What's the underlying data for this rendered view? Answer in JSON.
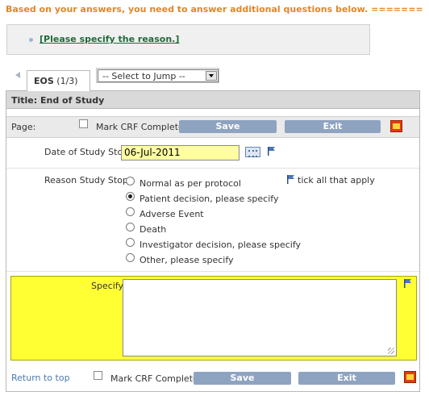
{
  "notice": {
    "message": "Based on your answers, you need to answer additional questions below. =======",
    "link": "[Please specify the reason.]"
  },
  "tabs": {
    "active_name": "EOS",
    "active_count": "(1/3)",
    "jump_select": "-- Select to Jump --"
  },
  "form": {
    "title": "Title: End of Study",
    "page_label": "Page:",
    "mark_complete_label": "Mark CRF Complete",
    "save_label": "Save",
    "exit_label": "Exit",
    "date_label": "Date of Study Stop",
    "date_value": "06-Jul-2011",
    "reason_label": "Reason Study Stop",
    "tick_hint": "tick all that apply",
    "reasons": [
      {
        "label": "Normal as per protocol",
        "selected": false
      },
      {
        "label": "Patient decision, please specify",
        "selected": true
      },
      {
        "label": "Adverse Event",
        "selected": false
      },
      {
        "label": "Death",
        "selected": false
      },
      {
        "label": "Investigator decision, please specify",
        "selected": false
      },
      {
        "label": "Other, please specify",
        "selected": false
      }
    ],
    "specify_label": "Specify",
    "specify_value": "",
    "return_link": "Return to top"
  },
  "colors": {
    "notice_text": "#e0862a",
    "link": "#1e6b3a",
    "button": "#8ea3c0",
    "highlight": "#ffff33",
    "date_field": "#ffffa0"
  }
}
